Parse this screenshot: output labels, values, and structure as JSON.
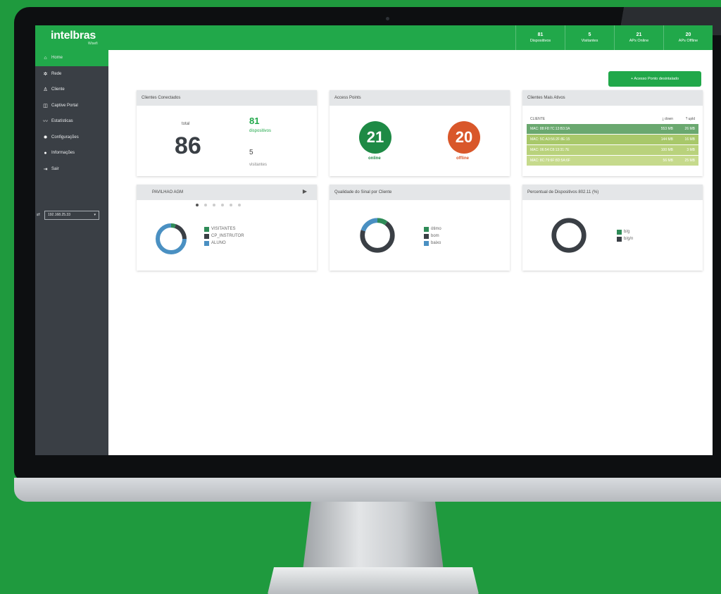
{
  "brand": {
    "logo": "intelbras",
    "sub": "Wisefi"
  },
  "topbar": {
    "stats": [
      {
        "num": "81",
        "label": "Dispositivos"
      },
      {
        "num": "5",
        "label": "Visitantes"
      },
      {
        "num": "21",
        "label": "APs Online"
      },
      {
        "num": "20",
        "label": "APs Offline"
      }
    ]
  },
  "sidebar": {
    "items": [
      {
        "label": "Home",
        "icon": "home-icon",
        "glyph": "⌂"
      },
      {
        "label": "Rede",
        "icon": "network-icon",
        "glyph": "✲"
      },
      {
        "label": "Cliente",
        "icon": "user-icon",
        "glyph": "♙"
      },
      {
        "label": "Captive Portal",
        "icon": "portal-icon",
        "glyph": "◫"
      },
      {
        "label": "Estatísticas",
        "icon": "chart-icon",
        "glyph": "〰"
      },
      {
        "label": "Configurações",
        "icon": "gear-icon",
        "glyph": "✹"
      },
      {
        "label": "Informações",
        "icon": "info-icon",
        "glyph": "●"
      },
      {
        "label": "Sair",
        "icon": "exit-icon",
        "glyph": "⇥"
      }
    ],
    "ip": "192.168.25.33"
  },
  "main": {
    "new_button": "+ Acesso Ponto desintalado"
  },
  "cards": {
    "clients": {
      "title": "Clientes Conectados",
      "total_label": "total",
      "total": "86",
      "devices_num": "81",
      "devices_label": "dispositivos",
      "visitors_num": "5",
      "visitors_label": "visitantes"
    },
    "aps": {
      "title": "Access Points",
      "online_num": "21",
      "online_label": "online",
      "offline_num": "20",
      "offline_label": "offline",
      "online_color": "#1e8a45",
      "offline_color": "#d9572a"
    },
    "top_clients": {
      "title": "Clientes Mais Ativos",
      "col_client": "CLIENTE",
      "col_down": "⤓ down",
      "col_up": "⤒ upld",
      "rows": [
        {
          "mac": "MAC: 88:F8:7C:13:B3:3A",
          "down": "553 MB",
          "up": "26 MB",
          "color": "#6aa86f"
        },
        {
          "mac": "MAC: 5C:A3:56:2F:8E:15",
          "down": "144 MB",
          "up": "16 MB",
          "color": "#a8c86a"
        },
        {
          "mac": "MAC: 06:54:C8:13:31:7E",
          "down": "100 MB",
          "up": "3 MB",
          "color": "#b9d27c"
        },
        {
          "mac": "MAC: 8C:79:6F:8D:5A:6F",
          "down": "56 MB",
          "up": "25 MB",
          "color": "#c6da8c"
        }
      ]
    },
    "pavilion": {
      "title": "PAVILHAO AGM",
      "legend": [
        {
          "label": "VISITANTES",
          "color": "#2e8b57"
        },
        {
          "label": "CP_INSTRUTOR",
          "color": "#3a3f45"
        },
        {
          "label": "ALUNO",
          "color": "#4a90c2"
        }
      ],
      "donut": [
        0.05,
        0.2,
        0.75
      ]
    },
    "signal": {
      "title": "Qualidade do Sinal por Cliente",
      "legend": [
        {
          "label": "ótimo",
          "color": "#2e8b57"
        },
        {
          "label": "bom",
          "color": "#3a3f45"
        },
        {
          "label": "baixo",
          "color": "#4a90c2"
        }
      ],
      "donut": [
        0.1,
        0.7,
        0.2
      ]
    },
    "percent": {
      "title": "Percentual de Dispositivos 802.11 (%)",
      "legend": [
        {
          "label": "b/g",
          "color": "#2e8b57"
        },
        {
          "label": "b/g/n",
          "color": "#3a3f45"
        }
      ],
      "donut": [
        0.0,
        1.0
      ]
    }
  }
}
